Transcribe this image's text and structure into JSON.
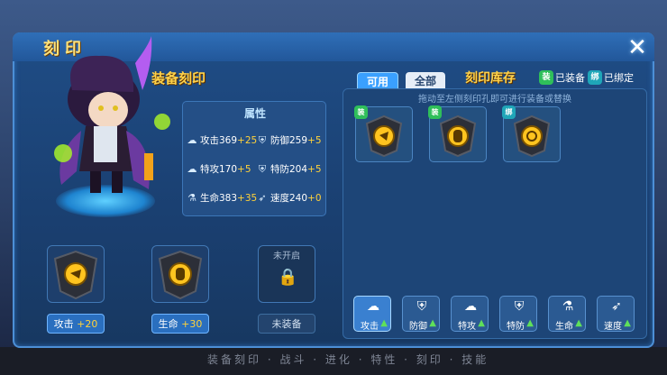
{
  "window": {
    "title": "刻印",
    "close_icon": "close-icon"
  },
  "equip_section": {
    "title": "装备刻印"
  },
  "stats": {
    "title": "属性",
    "items": [
      {
        "icon": "attack-icon",
        "label": "攻击",
        "value": "369",
        "bonus": "+25"
      },
      {
        "icon": "defense-icon",
        "label": "防御",
        "value": "259",
        "bonus": "+5"
      },
      {
        "icon": "sp-attack-icon",
        "label": "特攻",
        "value": "170",
        "bonus": "+5"
      },
      {
        "icon": "sp-defense-icon",
        "label": "特防",
        "value": "204",
        "bonus": "+5"
      },
      {
        "icon": "hp-icon",
        "label": "生命",
        "value": "383",
        "bonus": "+35"
      },
      {
        "icon": "speed-icon",
        "label": "速度",
        "value": "240",
        "bonus": "+0"
      }
    ]
  },
  "slots": [
    {
      "label": "攻击",
      "bonus": "+20",
      "state": "equipped"
    },
    {
      "label": "生命",
      "bonus": "+30",
      "state": "equipped"
    },
    {
      "label": "未装备",
      "bonus": "",
      "state": "locked",
      "lock_text": "未开启"
    }
  ],
  "inventory": {
    "tabs": [
      {
        "label": "可用",
        "active": true
      },
      {
        "label": "全部",
        "active": false
      }
    ],
    "title": "刻印库存",
    "legend": [
      {
        "badge": "装",
        "label": "已装备",
        "color": "#2fbf5a"
      },
      {
        "badge": "绑",
        "label": "已绑定",
        "color": "#1fa6b8"
      }
    ],
    "hint": "拖动至左侧刻印孔即可进行装备或替换",
    "cards": [
      {
        "badge": "装",
        "badge_color": "#2fbf5a"
      },
      {
        "badge": "装",
        "badge_color": "#2fbf5a"
      },
      {
        "badge": "绑",
        "badge_color": "#1fa6b8"
      }
    ],
    "filters": [
      {
        "icon": "attack-icon",
        "label": "攻击",
        "active": true
      },
      {
        "icon": "defense-icon",
        "label": "防御",
        "active": false
      },
      {
        "icon": "sp-attack-icon",
        "label": "特攻",
        "active": false
      },
      {
        "icon": "sp-defense-icon",
        "label": "特防",
        "active": false
      },
      {
        "icon": "hp-icon",
        "label": "生命",
        "active": false
      },
      {
        "icon": "speed-icon",
        "label": "速度",
        "active": false
      }
    ]
  },
  "background_text": "装备刻印 · 战斗 · 进化 · 特性 · 刻印 · 技能"
}
